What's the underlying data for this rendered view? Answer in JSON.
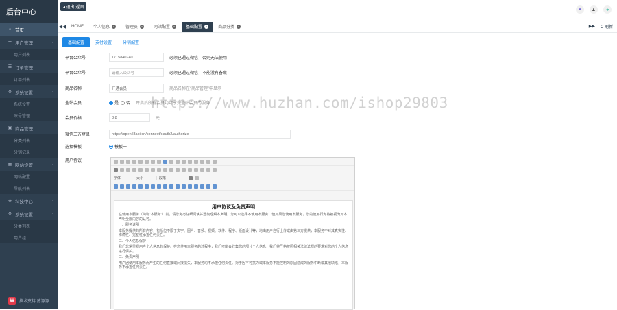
{
  "sidebar": {
    "brand": "后台中心",
    "items": [
      {
        "icon": "home-icon",
        "glyph": "⌂",
        "label": "首页",
        "active": true
      },
      {
        "icon": "user-icon",
        "glyph": "☰",
        "label": "用户管理",
        "caret": true,
        "subs": [
          "用户列表"
        ]
      },
      {
        "icon": "order-icon",
        "glyph": "☷",
        "label": "订单管理",
        "caret": true,
        "subs": [
          "订单列表"
        ]
      },
      {
        "icon": "settings-icon",
        "glyph": "⚙",
        "label": "系统设置",
        "caret": true,
        "subs": [
          "系统设置",
          "账号管理"
        ]
      },
      {
        "icon": "store-icon",
        "glyph": "▣",
        "label": "商品管理",
        "caret": true,
        "subs": [
          "分类列表",
          "分销记录"
        ]
      },
      {
        "icon": "site-icon",
        "glyph": "▦",
        "label": "网站设置",
        "caret": true,
        "subs": [
          "网站配置",
          "导航列表"
        ]
      },
      {
        "icon": "tech-icon",
        "glyph": "◈",
        "label": "科技中心",
        "caret": true,
        "subs": []
      },
      {
        "icon": "system-icon",
        "glyph": "⚙",
        "label": "系统设置",
        "caret": true,
        "subs": [
          "分类列表",
          "用户组"
        ]
      }
    ],
    "footer": "技术支持 苏源源"
  },
  "topbar": {
    "back_label": "◂ 退出/返回",
    "icons": [
      "palette-icon",
      "profile-icon",
      "logout-icon"
    ]
  },
  "page_tabs": [
    {
      "label": "HOME",
      "closable": false,
      "active": false
    },
    {
      "label": "个人信息",
      "closable": true,
      "active": false
    },
    {
      "label": "管理员",
      "closable": true,
      "active": false
    },
    {
      "label": "网站配置",
      "closable": true,
      "active": false
    },
    {
      "label": "基础配置",
      "closable": true,
      "active": true
    },
    {
      "label": "商品分类",
      "closable": true,
      "active": false
    }
  ],
  "tabs_right": {
    "refresh_label": "C 刷新"
  },
  "inner_tabs": [
    {
      "label": "基础配置",
      "active": true
    },
    {
      "label": "支付设置",
      "active": false
    },
    {
      "label": "分销配置",
      "active": false
    }
  ],
  "form": {
    "row1": {
      "label": "平台公众号",
      "value": "1715840740",
      "hint": "必须已通过微信，否则无法使用！"
    },
    "row2": {
      "label": "平台公众号",
      "placeholder": "请输入公众号",
      "hint": "必须已通过微信，不能没有备案！"
    },
    "row3": {
      "label": "商品名称",
      "value": "开通会员",
      "hint": "商品名称在“商品管理”中显示"
    },
    "row4": {
      "label": "全站会员",
      "opt_yes": "是",
      "opt_no": "否",
      "hint": "开启后所有会员均可享受全站会员的服务"
    },
    "row5": {
      "label": "会员价格",
      "value": "8.8",
      "unit": "元"
    },
    "row6": {
      "label": "微信三方登录",
      "value": "https://open.l3api.cn/connect/oauth2/authorize"
    },
    "row7": {
      "label": "选择模板",
      "option": "模板一"
    },
    "row8": {
      "label": "用户协议"
    }
  },
  "editor": {
    "font_select": "字体",
    "size_select": "大小",
    "para_select": "段落",
    "doc_title": "用户协议及免责声明",
    "paragraphs": [
      "在使用本服务（简称“本服务”）前，请您务必仔细阅读并透彻理解本声明。您可以选择不使用本服务，但如果您使用本服务，您的使用行为将被视为对本声明全部内容的认可。",
      "一、服务说明",
      "本服务提供的所有内容，包括但不限于文字、图片、音频、视频、软件、程序、版面设计等，均由用户自行上传或由第三方提供，本服务不对其真实性、准确性、完整性承担任何责任。",
      "二、个人信息保护",
      "我们非常重视用户个人信息的保护。在您使用本服务的过程中，我们可能会收集您的部分个人信息，我们将严格按照相关法律法规的要求对您的个人信息进行保护。",
      "三、免责声明",
      "用户因使用本服务而产生的任何直接或间接损失，本服务均不承担任何责任。对于因不可抗力或本服务不能控制的原因造成的服务中断或其他缺陷，本服务不承担任何责任。"
    ]
  },
  "watermark": "https://www.huzhan.com/ishop29803"
}
